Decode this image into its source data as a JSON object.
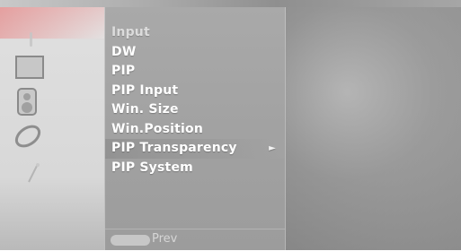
{
  "menu": {
    "items": [
      {
        "label": "Input"
      },
      {
        "label": "DW"
      },
      {
        "label": "PIP"
      },
      {
        "label": "PIP Input"
      },
      {
        "label": "Win. Size"
      },
      {
        "label": "Win.Position"
      },
      {
        "label": "PIP Transparency"
      },
      {
        "label": "PIP System"
      }
    ],
    "active_index": 6,
    "submenu_arrow": "►"
  },
  "footer": {
    "prev_label": "Prev"
  },
  "icons": {
    "category_icons": [
      "line-icon",
      "screen-icon",
      "speaker-icon",
      "disc-icon",
      "wand-icon"
    ]
  }
}
